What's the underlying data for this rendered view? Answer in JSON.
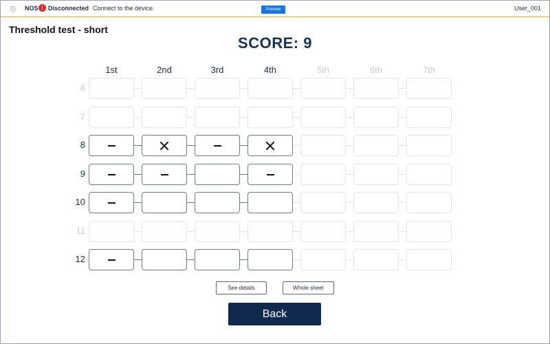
{
  "topbar": {
    "device": "NOS",
    "alert_glyph": "!",
    "status": "Disconnected",
    "message": "Connect to the device.",
    "preview_label": "Preview",
    "user": "User_001",
    "settings_icon": "gear-icon",
    "alert_icon": "alert-circle-icon",
    "alert_color": "#d32f2f",
    "preview_color": "#1a73e8",
    "accent_line_color": "#e6a23c"
  },
  "test_title": "Threshold test - short",
  "score": {
    "label": "SCORE:",
    "value": "9"
  },
  "columns": [
    {
      "label": "1st",
      "active": true
    },
    {
      "label": "2nd",
      "active": true
    },
    {
      "label": "3rd",
      "active": true
    },
    {
      "label": "4th",
      "active": true
    },
    {
      "label": "5th",
      "active": false
    },
    {
      "label": "6th",
      "active": false
    },
    {
      "label": "7th",
      "active": false
    }
  ],
  "rows": [
    {
      "label": "6",
      "active": false,
      "cells": [
        "",
        "",
        "",
        "",
        "",
        "",
        ""
      ]
    },
    {
      "label": "7",
      "active": false,
      "cells": [
        "",
        "",
        "",
        "",
        "",
        "",
        ""
      ]
    },
    {
      "label": "8",
      "active": true,
      "cells": [
        "dash",
        "cross",
        "dash",
        "cross",
        "",
        "",
        ""
      ]
    },
    {
      "label": "9",
      "active": true,
      "cells": [
        "dash",
        "dash",
        "",
        "dash",
        "",
        "",
        ""
      ]
    },
    {
      "label": "10",
      "active": true,
      "cells": [
        "dash",
        "",
        "",
        "",
        "",
        "",
        ""
      ]
    },
    {
      "label": "11",
      "active": false,
      "cells": [
        "",
        "",
        "",
        "",
        "",
        "",
        ""
      ]
    },
    {
      "label": "12",
      "active": true,
      "cells": [
        "dash",
        "",
        "",
        "",
        "",
        "",
        ""
      ]
    }
  ],
  "buttons": {
    "see_details": "See details",
    "whole_sheet": "Whole sheet",
    "back": "Back"
  },
  "colors": {
    "primary": "#0f2a4f",
    "active_border": "#6f7a88",
    "inactive_border": "#e2e6eb",
    "inactive_text": "#c5ccd6"
  }
}
